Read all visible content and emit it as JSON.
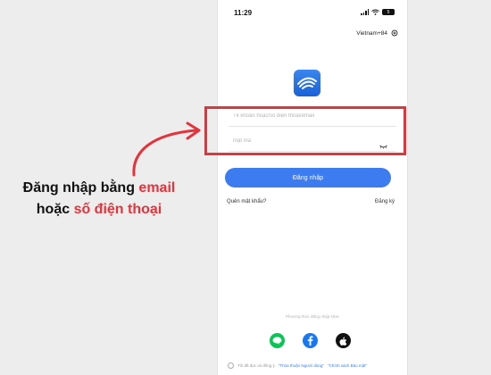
{
  "status_bar": {
    "time": "11:29",
    "battery": "5"
  },
  "header": {
    "region_label": "Vietnam+84"
  },
  "icons": {
    "logo": "eye-logo-icon",
    "settings": "gear-icon",
    "password_toggle": "eye-closed-icon",
    "social": [
      "line-icon",
      "facebook-icon",
      "apple-icon"
    ]
  },
  "form": {
    "account_placeholder": "Tk khoản hoặc/số điện thoại/email",
    "password_placeholder": "mật mã",
    "login_button": "Đăng nhập",
    "forgot_password": "Quên mật khẩu?",
    "register": "Đăng ký"
  },
  "footer": {
    "other_methods": "Phương thức đăng nhập khác",
    "terms_prefix": "Tôi đã đọc và đồng ý",
    "terms_link_1": "\"Thỏa thuận Người dùng\"",
    "terms_link_2": "\"Chính sách Bảo mật\""
  },
  "annotation": {
    "line1_normal": "Đăng nhập bằng ",
    "line1_accent": "email",
    "line2_normal": "hoặc ",
    "line2_accent": "số điện thoại",
    "accent_color": "#e5333c"
  },
  "colors": {
    "primary": "#3d7cf0",
    "highlight": "#e5333c"
  }
}
